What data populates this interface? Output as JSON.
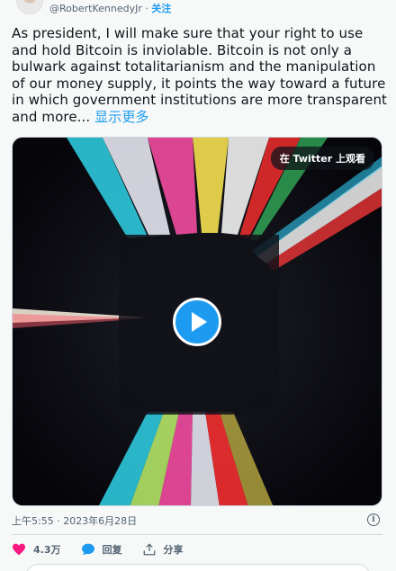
{
  "author": {
    "handle": "@RobertKennedyJr",
    "separator": " · ",
    "follow_label": "关注"
  },
  "tweet": {
    "text": "As president, I will make sure that your right to use and hold Bitcoin is inviolable. Bitcoin is not only a bulwark against totalitarianism and the manipulation of our money supply, it points the way toward a future in which government institutions are more transparent and more...",
    "show_more_label": "显示更多"
  },
  "video": {
    "watch_on_label": "在 Twitter 上观看",
    "play_icon": "play-icon"
  },
  "timestamp": "上午5:55 · 2023年6月28日",
  "actions": {
    "likes_count": "4.3万",
    "reply_label": "回复",
    "share_label": "分享"
  },
  "colors": {
    "accent": "#1d9bf0",
    "like": "#f91880",
    "text": "#0f1419",
    "muted": "#536471"
  }
}
